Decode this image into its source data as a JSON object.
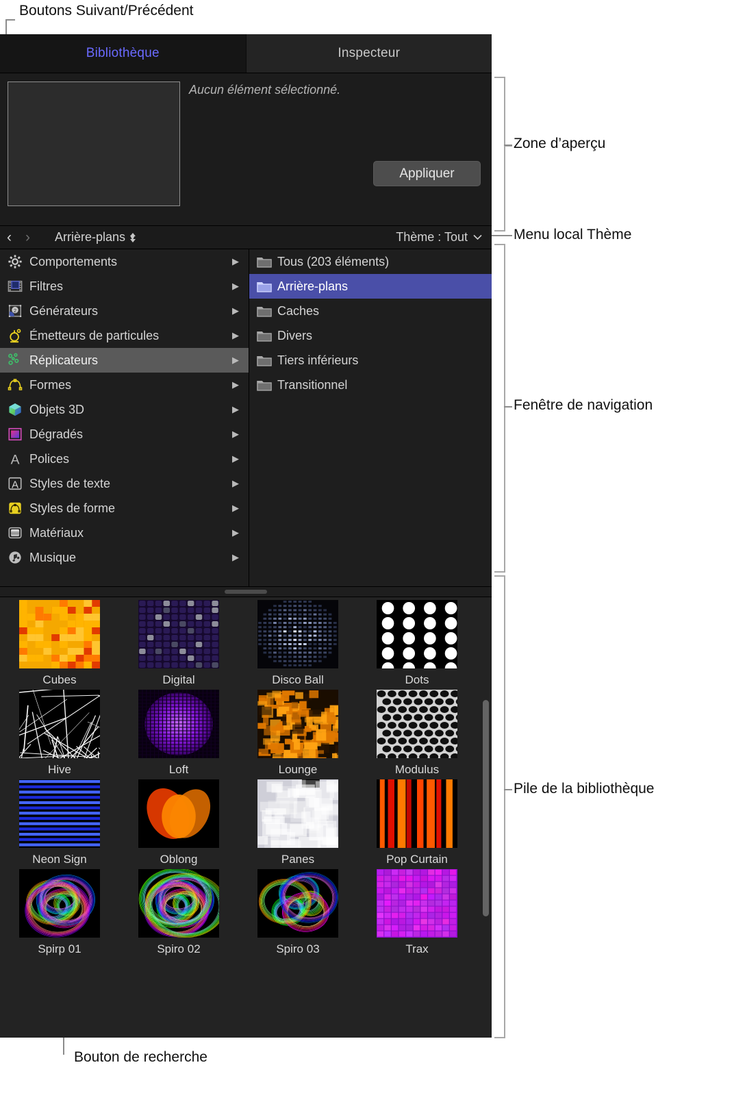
{
  "annotations": [
    {
      "id": "next-prev",
      "text": "Boutons Suivant/Précédent"
    },
    {
      "id": "preview",
      "text": "Zone d’aperçu"
    },
    {
      "id": "theme-menu",
      "text": "Menu local Thème"
    },
    {
      "id": "navigator",
      "text": "Fenêtre de navigation"
    },
    {
      "id": "stack",
      "text": "Pile de la bibliothèque"
    },
    {
      "id": "search",
      "text": "Bouton de recherche"
    }
  ],
  "tabs": [
    {
      "label": "Bibliothèque",
      "active": true
    },
    {
      "label": "Inspecteur",
      "active": false
    }
  ],
  "preview": {
    "message": "Aucun élément sélectionné.",
    "apply_label": "Appliquer"
  },
  "pathbar": {
    "back_icon": "chevron-left-icon",
    "forward_icon": "chevron-right-icon",
    "current": "Arrière-plans",
    "stepper_icon": "up-down-stepper-icon",
    "theme_label": "Thème : Tout",
    "theme_chevron": "chevron-down-icon"
  },
  "navigator": {
    "categories": [
      {
        "label": "Comportements",
        "icon": "gear-icon",
        "state": "normal"
      },
      {
        "label": "Filtres",
        "icon": "filmstrip-icon",
        "state": "normal"
      },
      {
        "label": "Générateurs",
        "icon": "generator-icon",
        "state": "normal"
      },
      {
        "label": "Émetteurs de particules",
        "icon": "particle-emitter-icon",
        "state": "normal"
      },
      {
        "label": "Réplicateurs",
        "icon": "replicator-icon",
        "state": "selected-grey"
      },
      {
        "label": "Formes",
        "icon": "shapes-icon",
        "state": "normal"
      },
      {
        "label": "Objets 3D",
        "icon": "cube-icon",
        "state": "normal"
      },
      {
        "label": "Dégradés",
        "icon": "gradient-icon",
        "state": "normal"
      },
      {
        "label": "Polices",
        "icon": "font-icon",
        "state": "normal"
      },
      {
        "label": "Styles de texte",
        "icon": "text-style-icon",
        "state": "normal"
      },
      {
        "label": "Styles de forme",
        "icon": "shape-style-icon",
        "state": "normal"
      },
      {
        "label": "Matériaux",
        "icon": "material-icon",
        "state": "normal"
      },
      {
        "label": "Musique",
        "icon": "music-note-icon",
        "state": "normal"
      }
    ],
    "folders": [
      {
        "label": "Tous (203 éléments)",
        "state": "normal"
      },
      {
        "label": "Arrière-plans",
        "state": "selected-blue"
      },
      {
        "label": "Caches",
        "state": "normal"
      },
      {
        "label": "Divers",
        "state": "normal"
      },
      {
        "label": "Tiers inférieurs",
        "state": "normal"
      },
      {
        "label": "Transitionnel",
        "state": "normal"
      }
    ]
  },
  "stack": {
    "items": [
      {
        "name": "Cubes",
        "art": "cubes"
      },
      {
        "name": "Digital",
        "art": "digital"
      },
      {
        "name": "Disco Ball",
        "art": "discoball"
      },
      {
        "name": "Dots",
        "art": "dots"
      },
      {
        "name": "Hive",
        "art": "hive"
      },
      {
        "name": "Loft",
        "art": "loft"
      },
      {
        "name": "Lounge",
        "art": "lounge"
      },
      {
        "name": "Modulus",
        "art": "modulus"
      },
      {
        "name": "Neon Sign",
        "art": "neonsign"
      },
      {
        "name": "Oblong",
        "art": "oblong"
      },
      {
        "name": "Panes",
        "art": "panes"
      },
      {
        "name": "Pop Curtain",
        "art": "popcurtain"
      },
      {
        "name": "Spirp 01",
        "art": "spiro1"
      },
      {
        "name": "Spiro 02",
        "art": "spiro2"
      },
      {
        "name": "Spiro 03",
        "art": "spiro3"
      },
      {
        "name": "Trax",
        "art": "trax"
      }
    ]
  },
  "toolbar": {
    "left": [
      {
        "icon": "new-folder-icon"
      },
      {
        "icon": "search-icon"
      },
      {
        "icon": "preview-panel-icon"
      }
    ],
    "right": [
      {
        "icon": "grid-view-icon"
      },
      {
        "icon": "list-view-icon"
      }
    ]
  },
  "colors": {
    "accent_tab": "#6a6aff",
    "selection_blue": "#4a4fa8",
    "selection_grey": "#5a5a5a",
    "panel_bg": "#1e1e1e",
    "stack_bg": "#232323"
  }
}
